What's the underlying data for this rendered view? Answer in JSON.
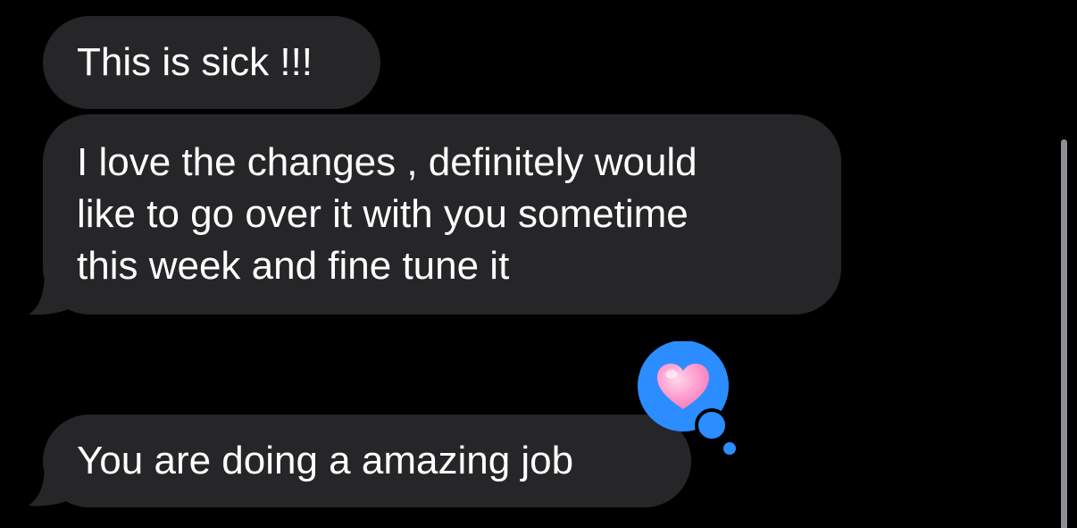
{
  "conversation": {
    "messages": [
      {
        "text": "This is sick !!!"
      },
      {
        "lines": [
          "I love the changes , definitely would",
          "like to go over it with you sometime",
          "this week and fine tune it"
        ]
      },
      {
        "text": "You are doing a amazing job",
        "reaction": "heart"
      }
    ]
  },
  "colors": {
    "background": "#000000",
    "incoming_bubble": "#262628",
    "text": "#ffffff",
    "reaction_bubble": "#2b8dff",
    "heart": "#ff9ecf",
    "scrollbar": "#8e8e93"
  },
  "icons": {
    "reaction": "heart-icon"
  }
}
